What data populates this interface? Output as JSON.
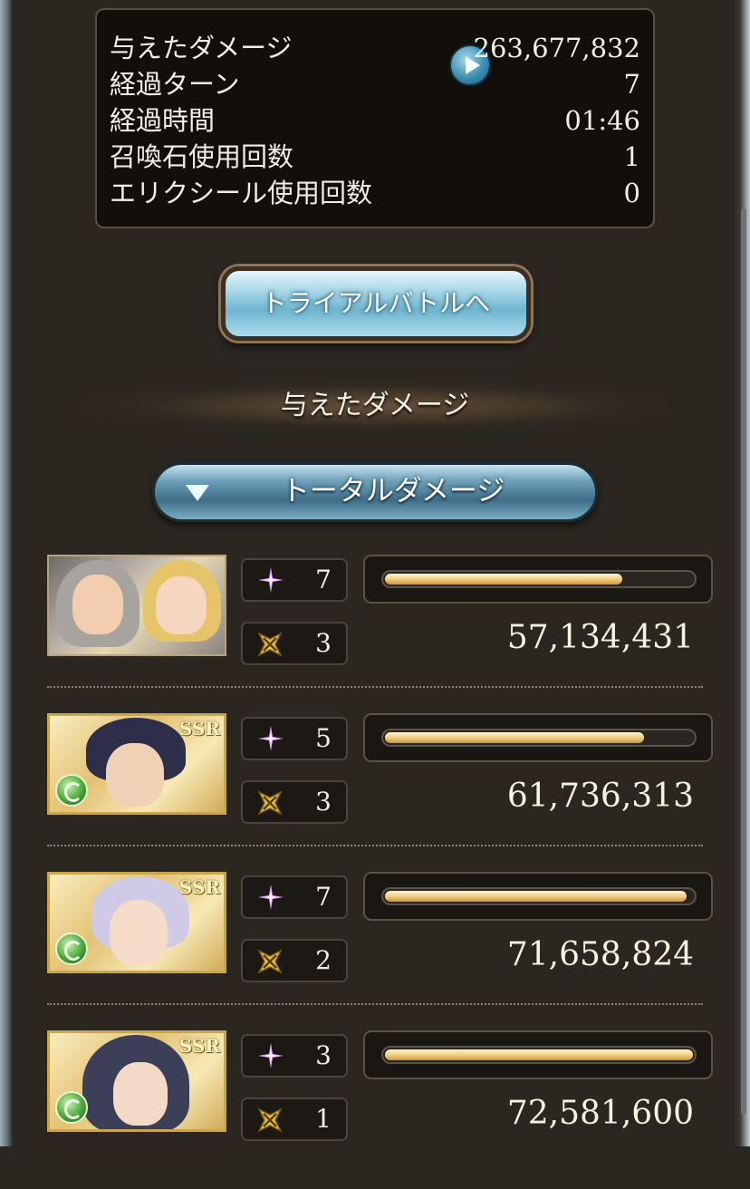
{
  "summary": {
    "damage_label": "与えたダメージ",
    "damage_value": "263,677,832",
    "turns_label": "経過ターン",
    "turns_value": "7",
    "time_label": "経過時間",
    "time_value": "01:46",
    "summon_label": "召喚石使用回数",
    "summon_value": "1",
    "elixir_label": "エリクシール使用回数",
    "elixir_value": "0"
  },
  "trial_button_label": "トライアルバトルへ",
  "section_title": "与えたダメージ",
  "dropdown_label": "トータルダメージ",
  "characters": [
    {
      "stars": "7",
      "ougi": "3",
      "damage": "57,134,431",
      "bar_fraction": 0.77,
      "ssr": "",
      "element": ""
    },
    {
      "stars": "5",
      "ougi": "3",
      "damage": "61,736,313",
      "bar_fraction": 0.84,
      "ssr": "SSR",
      "element": "wind"
    },
    {
      "stars": "7",
      "ougi": "2",
      "damage": "71,658,824",
      "bar_fraction": 0.98,
      "ssr": "SSR",
      "element": "wind"
    },
    {
      "stars": "3",
      "ougi": "1",
      "damage": "72,581,600",
      "bar_fraction": 1.0,
      "ssr": "SSR",
      "element": "wind"
    }
  ],
  "colors": {
    "bar_gold": "#f3cf84",
    "panel_bg": "#120f0b",
    "accent_blue": "#6fb5cf"
  }
}
